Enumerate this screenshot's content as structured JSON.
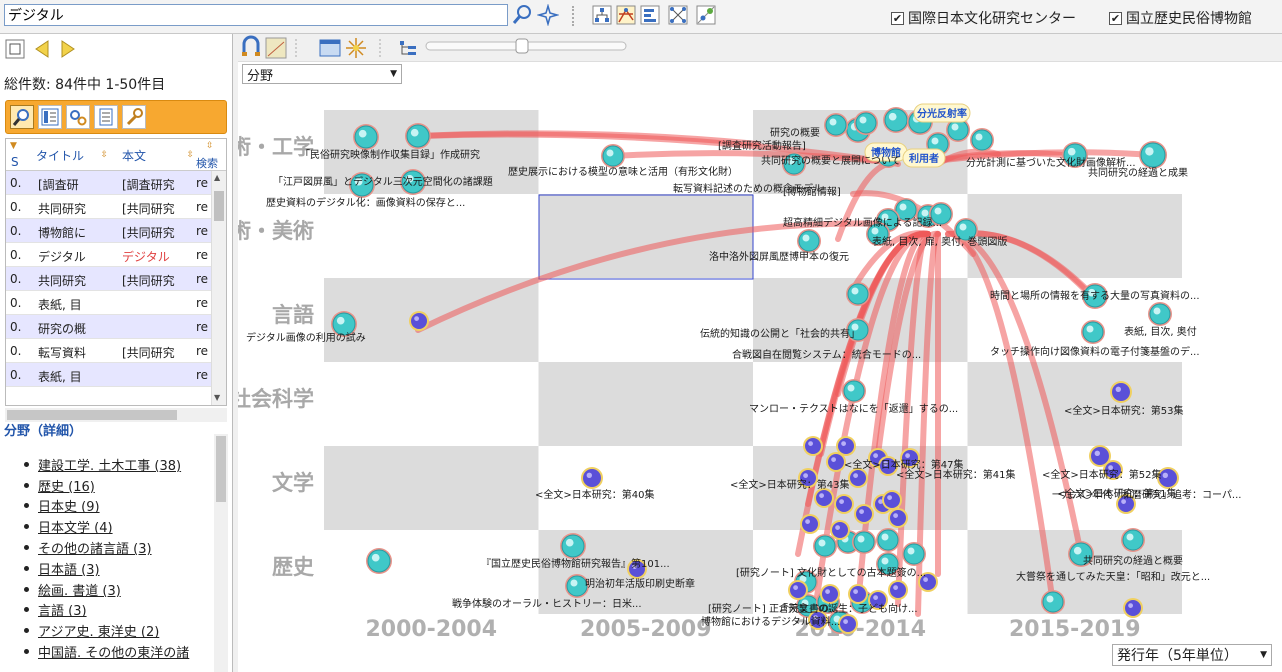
{
  "search": {
    "value": "デジタル"
  },
  "sources": [
    {
      "label": "国際日本文化研究センター",
      "checked": true
    },
    {
      "label": "国立歴史民俗博物館",
      "checked": true
    }
  ],
  "total_label": "総件数: 84件中 1-50件目",
  "table": {
    "columns": [
      "S",
      "タイトル",
      "本文",
      "検索"
    ],
    "rows": [
      {
        "s": "0.",
        "title": "[調査研",
        "body": "[調査研究",
        "extra": "re"
      },
      {
        "s": "0.",
        "title": "共同研究",
        "body": "[共同研究",
        "extra": "re"
      },
      {
        "s": "0.",
        "title": "博物館に",
        "body": "[共同研究",
        "extra": "re"
      },
      {
        "s": "0.",
        "title": "デジタル",
        "body": "デジタル",
        "extra": "re"
      },
      {
        "s": "0.",
        "title": "共同研究",
        "body": "[共同研究",
        "extra": "re"
      },
      {
        "s": "0.",
        "title": "表紙, 目",
        "body": "",
        "extra": "re"
      },
      {
        "s": "0.",
        "title": "研究の概",
        "body": "",
        "extra": "re"
      },
      {
        "s": "0.",
        "title": "転写資料",
        "body": "[共同研究",
        "extra": "re"
      },
      {
        "s": "0.",
        "title": "表紙, 目",
        "body": "",
        "extra": "re"
      }
    ]
  },
  "facet": {
    "title": "分野（詳細）",
    "items": [
      "建設工学. 土木工事 (38)",
      "歴史 (16)",
      "日本史 (9)",
      "日本文学 (4)",
      "その他の諸言語 (3)",
      "日本語 (3)",
      "絵画. 書道 (3)",
      "言語 (3)",
      "アジア史. 東洋史 (2)",
      "中国語. その他の東洋の諸"
    ]
  },
  "field_select": "分野",
  "year_select": "発行年（5年単位）",
  "grid": {
    "rows": [
      "術・工学",
      "術・美術",
      "言語",
      "社会科学",
      "文学",
      "歴史"
    ],
    "cols": [
      "2000-2004",
      "2005-2009",
      "2010-2014",
      "2015-2019"
    ]
  },
  "bubbles": [
    "分光反射率",
    "博物館",
    "利用者"
  ],
  "node_labels": [
    "「民俗研究映像制作収集目録」作成研究",
    "「江戸図屏風」とデジタル三次元空間化の諸課題",
    "歴史資料のデジタル化：画像資料の保存と...",
    "歴史展示における模型の意味と活用（有形文化財）",
    "[調査研究活動報告]",
    "研究の概要",
    "共同研究の概要と展開について",
    "転写資料記述のための概念モデル",
    "[博物館情報]",
    "表紙, 目次, 扉, 奥付, 巻頭図版",
    "洛中洛外図屏風歴博甲本の復元",
    "超高精細デジタル画像による記録...",
    "分光計測に基づいた文化財画像解析...",
    "共同研究の経過と成果",
    "デジタル画像の利用の試み",
    "伝統的知識の公開と「社会的共有」",
    "合戦図自在閲覧システム：統合モードの...",
    "時間と場所の情報を有する大量の写真資料の...",
    "表紙, 目次, 奥付",
    "タッチ操作向け図像資料の電子付箋基盤のデ...",
    "マンロー・テクストはなにを「返還」するの...",
    "<全文>日本研究：第53集",
    "<全文>日本研究：第40集",
    "<全文>日本研究：第52集",
    "<全文>日本研究：第51集",
    "<全文>日本研究：第43集",
    "<全文>日本研究：第47集",
    "<全文>日本研究：第41集",
    "一九六〇年代「和暦研究」追考：コーパ...",
    "共同研究の経過と概要",
    "『国立歴史民俗博物館研究報告』第101...",
    "明治初年活版印刷史断章",
    "戦争体験のオーラル・ヒストリー：日米...",
    "[研究ノート] 文化財としての古本題簽の...",
    "[研究ノート] 正倉院文書の...",
    "博物館におけるデジタル資料...",
    "「天皇」の誕生：子ども向け...",
    "大嘗祭を通してみた天皇：「昭和」改元と..."
  ]
}
